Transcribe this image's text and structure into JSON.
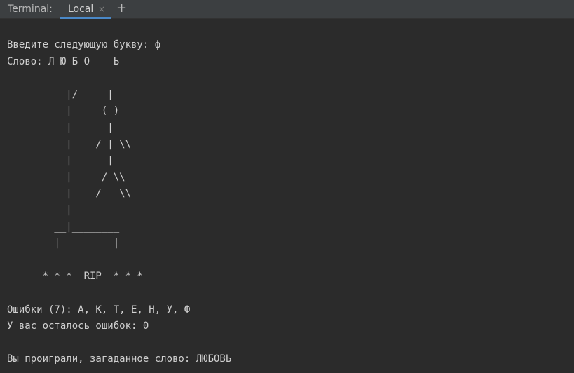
{
  "tool_window": {
    "title": "Terminal:",
    "tab_label": "Local",
    "tab_close_glyph": "×",
    "new_tab_glyph": "+"
  },
  "terminal": {
    "lines": [
      "Введите следующую букву: ф",
      "Слово: Л Ю Б О __ Ь",
      "          _______",
      "          |/     |",
      "          |     (_)",
      "          |     _|_",
      "          |    / | \\\\",
      "          |      |",
      "          |     / \\\\",
      "          |    /   \\\\",
      "          |",
      "        __|________",
      "        |         |",
      "",
      "      * * *  RIP  * * *",
      "",
      "Ошибки (7): А, К, Т, Е, Н, У, Ф",
      "У вас осталось ошибок: 0",
      "",
      "Вы проиграли, загаданное слово: ЛЮБОВЬ"
    ]
  },
  "colors": {
    "background": "#2b2b2b",
    "tabbar": "#3c3f41",
    "text": "#d0d0d0",
    "accent": "#4a88c7"
  }
}
